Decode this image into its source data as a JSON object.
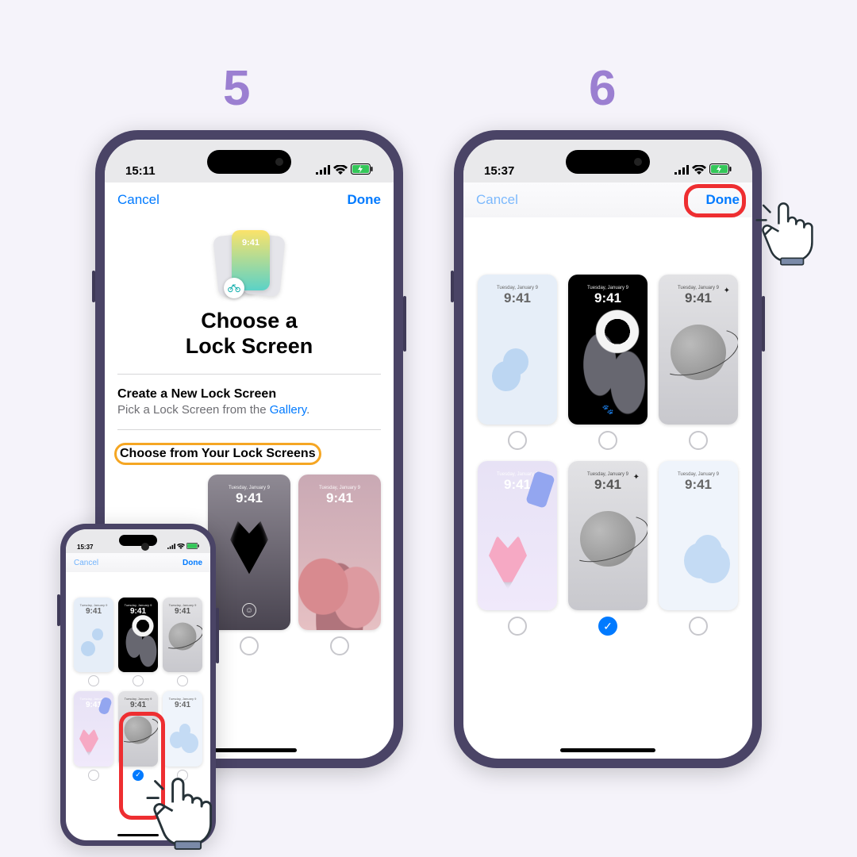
{
  "steps": {
    "s5": "5",
    "s6": "6"
  },
  "common": {
    "cancel": "Cancel",
    "done": "Done",
    "thumb_time": "9:41",
    "thumb_date": "Tuesday, January 9",
    "hero_card_time": "9:41"
  },
  "phone5": {
    "time": "15:11",
    "title_l1": "Choose a",
    "title_l2": "Lock Screen",
    "create_heading": "Create a New Lock Screen",
    "create_sub_pre": "Pick a Lock Screen from the ",
    "create_sub_link": "Gallery",
    "create_sub_post": ".",
    "choose_heading": "Choose from Your Lock Screens"
  },
  "phone6": {
    "time": "15:37"
  },
  "mini": {
    "time": "15:37"
  }
}
